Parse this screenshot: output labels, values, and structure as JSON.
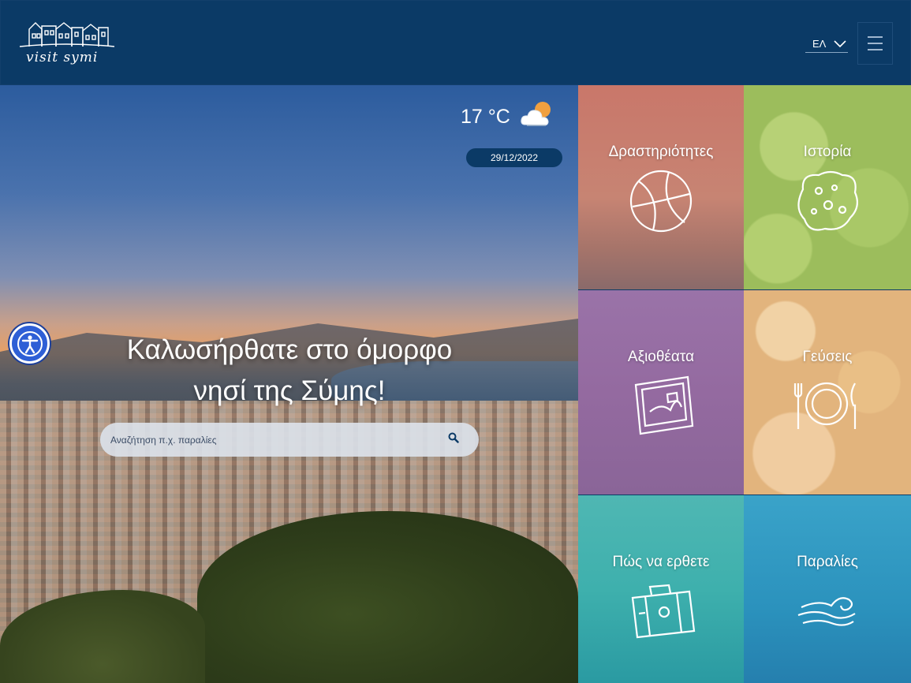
{
  "header": {
    "logo_text": "visit symi",
    "language": "ΕΛ"
  },
  "hero": {
    "temperature": "17 °C",
    "date": "29/12/2022",
    "welcome_line1": "Καλωσήρθατε στο όμορφο",
    "welcome_line2": "νησί της Σύμης!",
    "search_placeholder": "Αναζήτηση π.χ. παραλίες"
  },
  "tiles": [
    {
      "label": "Δραστηριότητες",
      "icon": "ball-icon"
    },
    {
      "label": "Ιστορία",
      "icon": "sponge-icon"
    },
    {
      "label": "Αξιοθέατα",
      "icon": "postcard-icon"
    },
    {
      "label": "Γεύσεις",
      "icon": "plate-cutlery-icon"
    },
    {
      "label": "Πώς να ερθετε",
      "icon": "suitcase-icon"
    },
    {
      "label": "Παραλίες",
      "icon": "wave-icon"
    }
  ],
  "colors": {
    "header_bg": "#0b3a66",
    "activities_tile": "#c9776a",
    "history_tile": "#9cbd5c",
    "sights_tile": "#946aa0",
    "tastes_tile": "#e2b47d",
    "getting_here_tile": "#3eb0ad",
    "beaches_tile": "#2b92bd"
  }
}
